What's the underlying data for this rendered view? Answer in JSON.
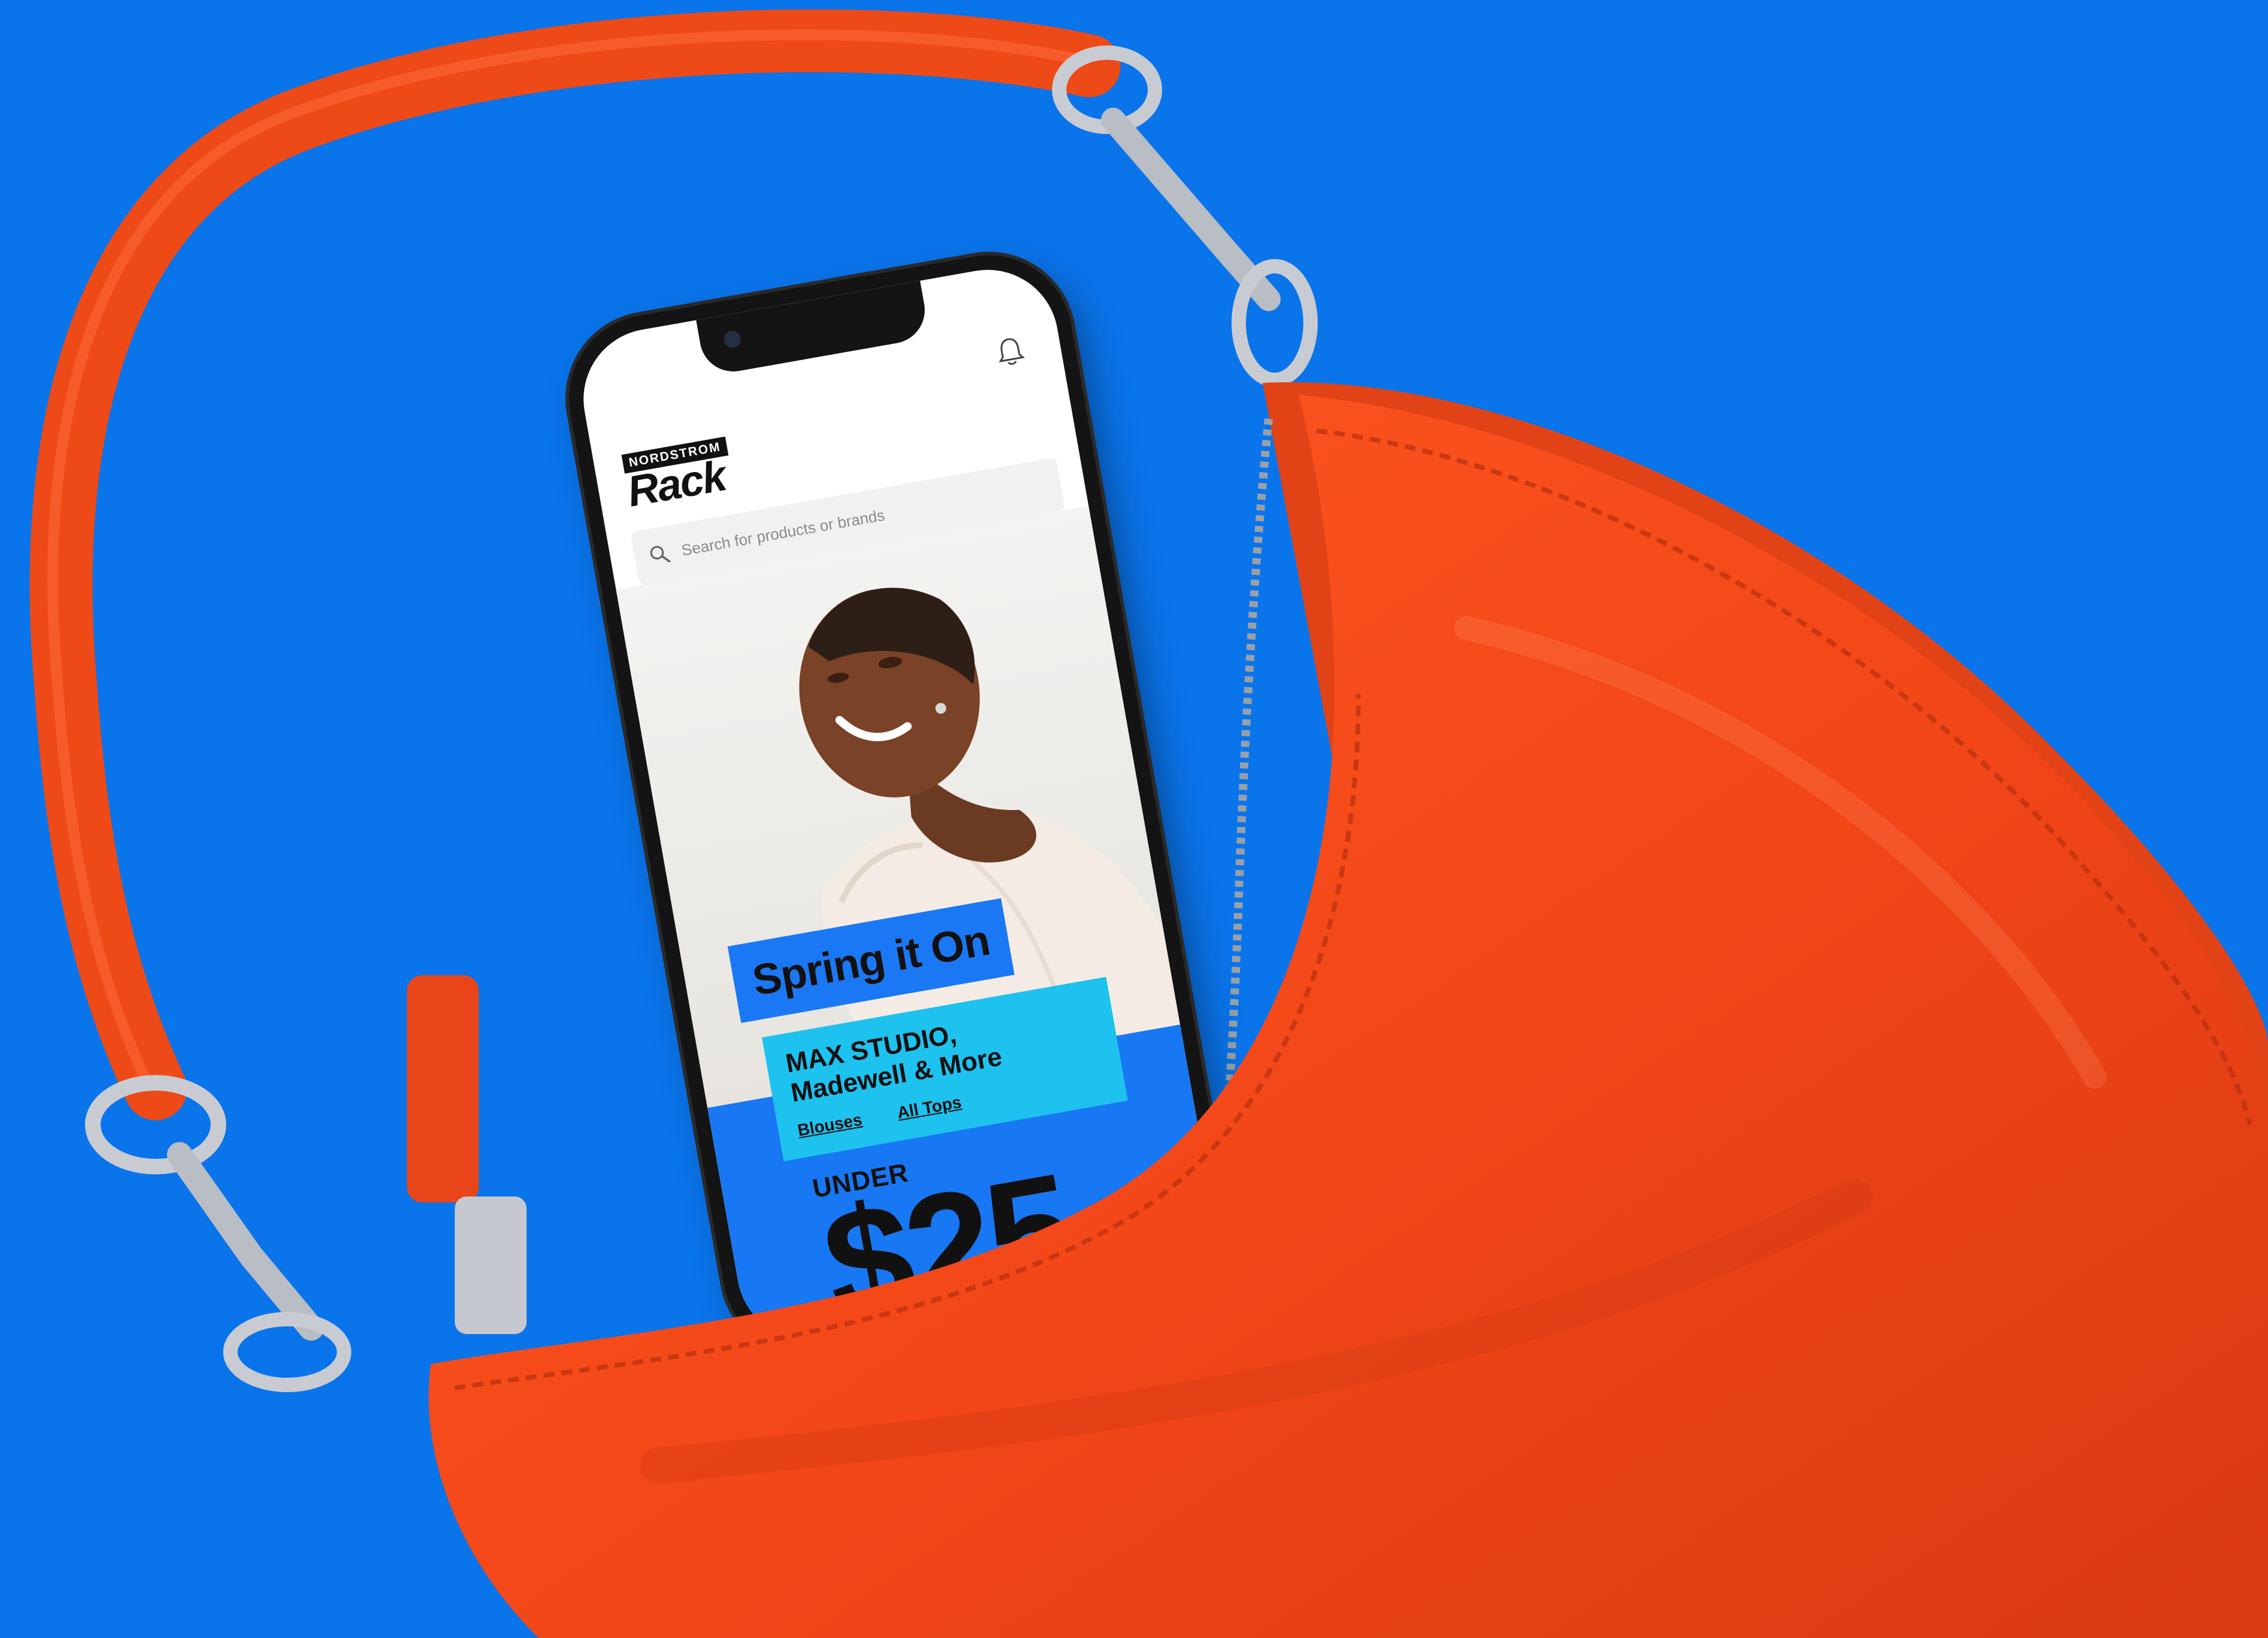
{
  "logo": {
    "top_line": "NORDSTROM",
    "main": "Rack"
  },
  "search": {
    "placeholder": "Search for products or brands"
  },
  "hero": {
    "headline": "Spring it On"
  },
  "promo": {
    "line_1": "MAX STUDIO,",
    "line_2": "Madewell & More",
    "links": [
      "Blouses",
      "All Tops"
    ]
  },
  "deal": {
    "label": "UNDER",
    "amount": "$25"
  },
  "icons": [
    "bell-icon",
    "search-icon"
  ],
  "colors": {
    "background": "#0a74ea",
    "bag": "#f0461a",
    "promo_blue": "#1877f2",
    "promo_cyan": "#1ec2ef"
  }
}
